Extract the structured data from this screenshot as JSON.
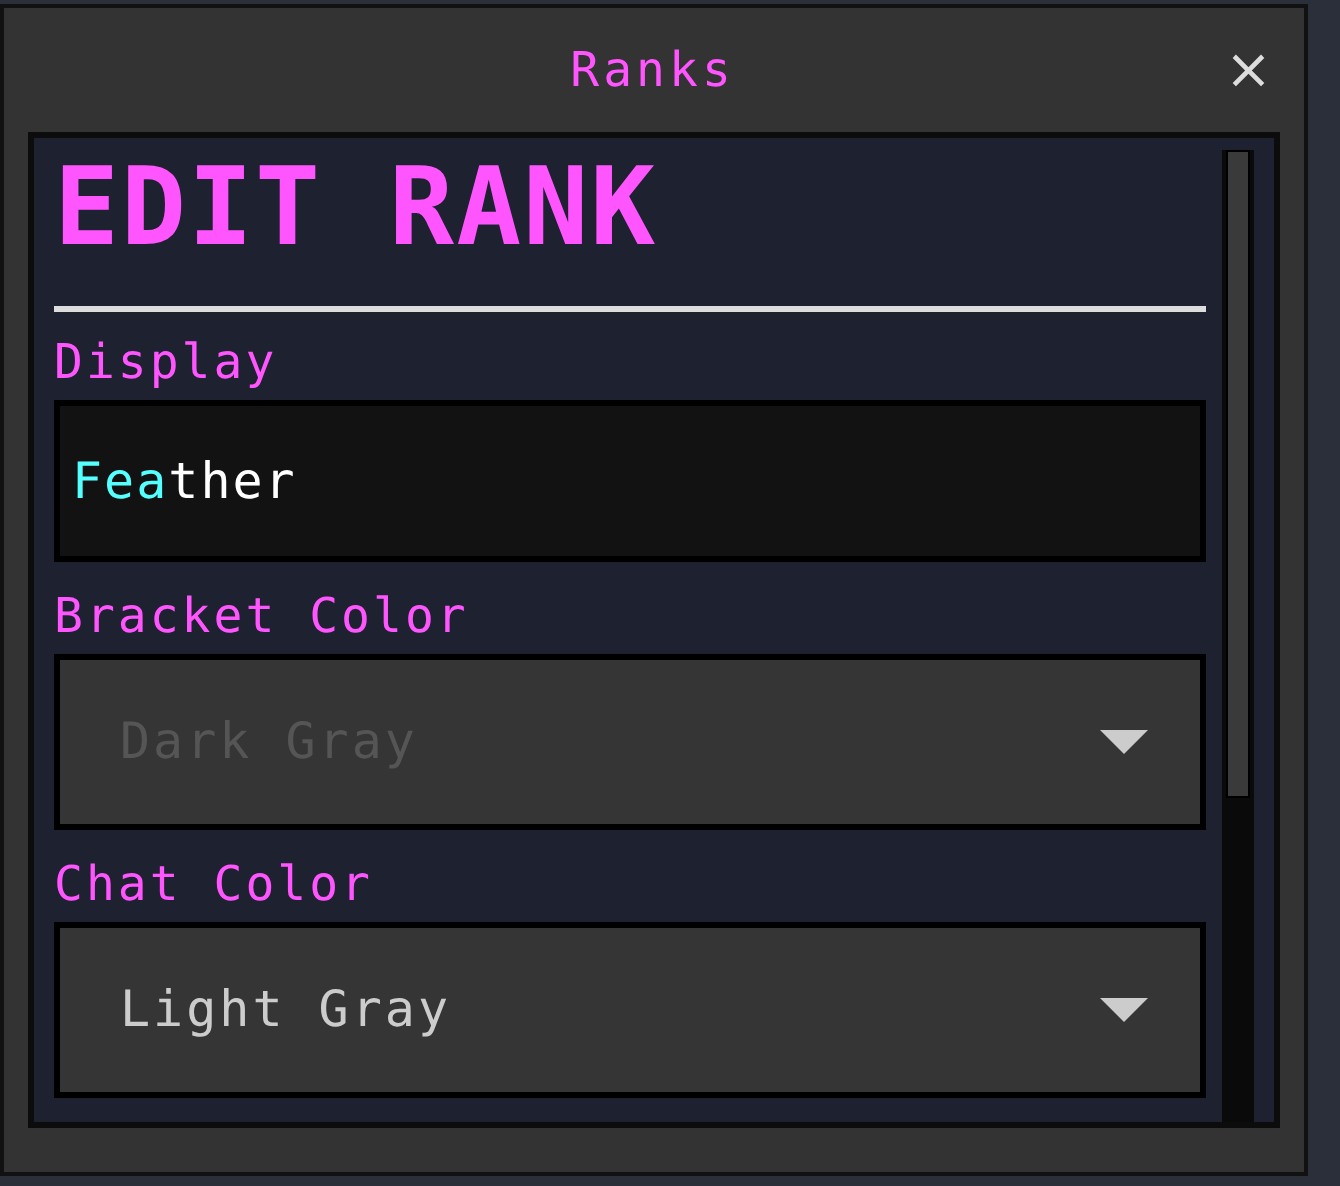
{
  "window": {
    "title": "Ranks",
    "close": "×"
  },
  "heading": "EDIT RANK",
  "fields": [
    {
      "kind": "text",
      "label": "Display",
      "segments": [
        {
          "text": "Fea",
          "color": "#55ffff"
        },
        {
          "text": "ther",
          "color": "#ffffff"
        }
      ]
    },
    {
      "kind": "dropdown",
      "label": "Bracket Color",
      "value": "Dark Gray",
      "color": "#555555"
    },
    {
      "kind": "dropdown",
      "label": "Chat Color",
      "value": "Light Gray",
      "color": "#cccccc"
    }
  ]
}
